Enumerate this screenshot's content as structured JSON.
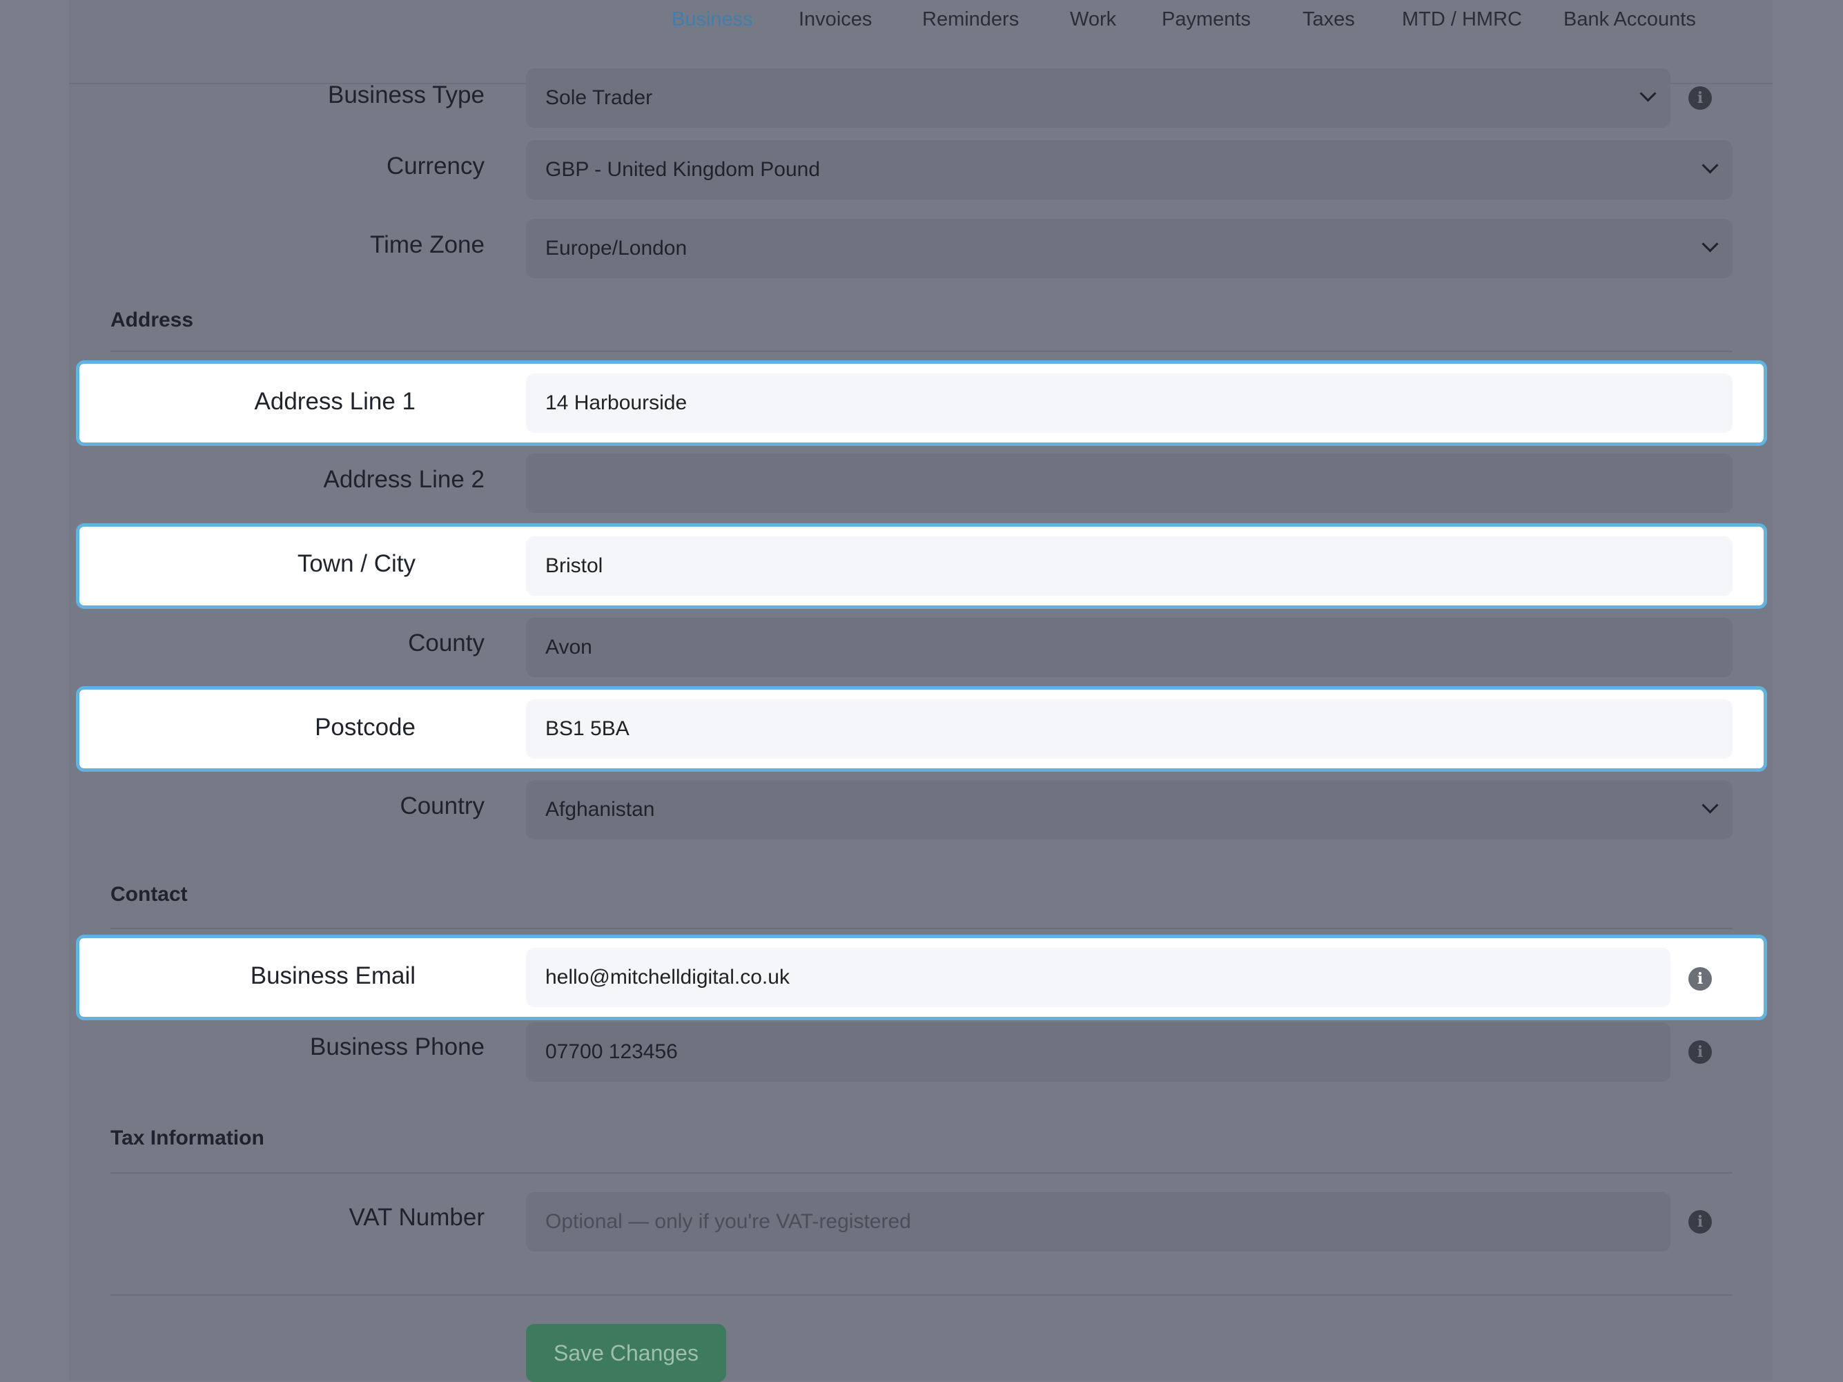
{
  "nav": {
    "items": [
      {
        "label": "Business",
        "active": true
      },
      {
        "label": "Invoices"
      },
      {
        "label": "Reminders"
      },
      {
        "label": "Work"
      },
      {
        "label": "Payments"
      },
      {
        "label": "Taxes"
      },
      {
        "label": "MTD / HMRC"
      },
      {
        "label": "Bank Accounts"
      }
    ]
  },
  "business": {
    "business_type": {
      "label": "Business Type",
      "value": "Sole Trader"
    },
    "currency": {
      "label": "Currency",
      "value": "GBP - United Kingdom Pound"
    },
    "time_zone": {
      "label": "Time Zone",
      "value": "Europe/London"
    }
  },
  "address": {
    "title": "Address",
    "line1": {
      "label": "Address Line 1",
      "value": "14 Harbourside"
    },
    "line2": {
      "label": "Address Line 2",
      "value": ""
    },
    "town": {
      "label": "Town / City",
      "value": "Bristol"
    },
    "county": {
      "label": "County",
      "value": "Avon"
    },
    "postcode": {
      "label": "Postcode",
      "value": "BS1 5BA"
    },
    "country": {
      "label": "Country",
      "value": "Afghanistan"
    }
  },
  "contact": {
    "title": "Contact",
    "email": {
      "label": "Business Email",
      "value": "hello@mitchelldigital.co.uk"
    },
    "phone": {
      "label": "Business Phone",
      "value": "07700 123456"
    }
  },
  "tax": {
    "title": "Tax Information",
    "vat": {
      "label": "VAT Number",
      "value": "",
      "placeholder": "Optional — only if you're VAT-registered"
    }
  },
  "actions": {
    "save_label": "Save Changes"
  },
  "icons": {
    "info": "info-icon",
    "dropdown": "chevron-down-icon"
  },
  "colors": {
    "highlight_border": "#62b3df",
    "active_nav": "#3f7fb0",
    "save_button": "#3e7a5c"
  }
}
